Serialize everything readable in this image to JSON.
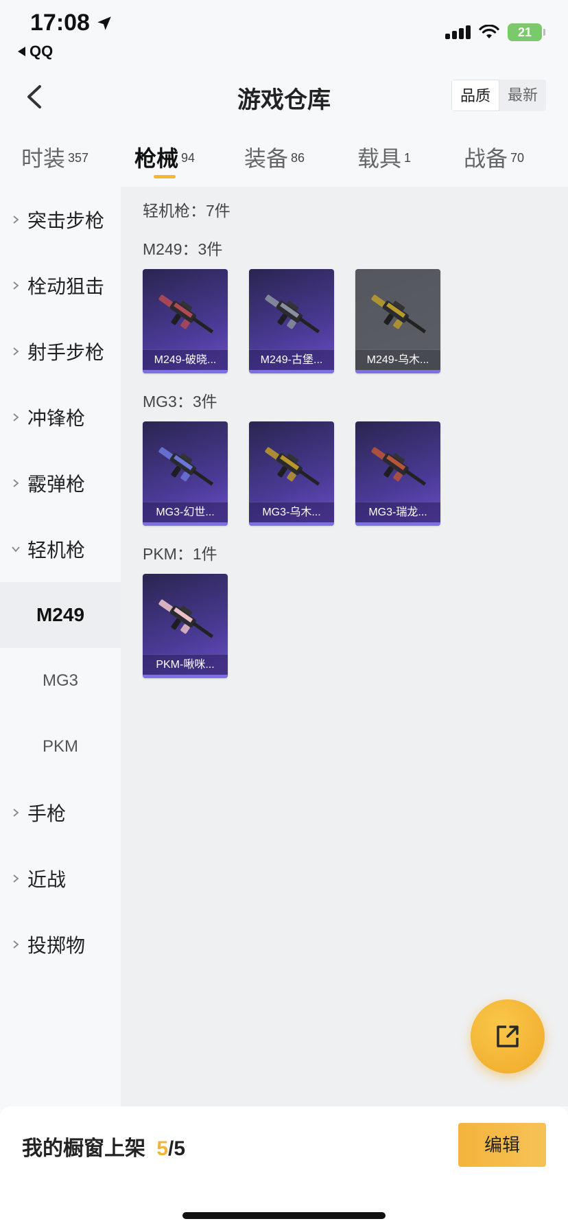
{
  "status": {
    "time": "17:08",
    "back_app": "QQ",
    "battery": "21"
  },
  "header": {
    "title": "游戏仓库",
    "sort_options": [
      "品质",
      "最新"
    ],
    "sort_active": 0
  },
  "tabs": [
    {
      "label": "时装",
      "count": "357"
    },
    {
      "label": "枪械",
      "count": "94"
    },
    {
      "label": "装备",
      "count": "86"
    },
    {
      "label": "载具",
      "count": "1"
    },
    {
      "label": "战备",
      "count": "70"
    }
  ],
  "active_tab": 1,
  "sidebar": {
    "items": [
      {
        "label": "突击步枪"
      },
      {
        "label": "栓动狙击"
      },
      {
        "label": "射手步枪"
      },
      {
        "label": "冲锋枪"
      },
      {
        "label": "霰弹枪"
      },
      {
        "label": "轻机枪"
      }
    ],
    "subitems": [
      "M249",
      "MG3",
      "PKM"
    ],
    "items_after": [
      {
        "label": "手枪"
      },
      {
        "label": "近战"
      },
      {
        "label": "投掷物"
      }
    ]
  },
  "content": {
    "category_title": "轻机枪：7件",
    "groups": [
      {
        "title": "M249：3件",
        "items": [
          {
            "name": "M249-破晓...",
            "color": "#b24a52"
          },
          {
            "name": "M249-古堡...",
            "color": "#8a8fa0"
          },
          {
            "name": "M249-乌木...",
            "color": "#b89a2c"
          }
        ]
      },
      {
        "title": "MG3：3件",
        "items": [
          {
            "name": "MG3-幻世...",
            "color": "#6b75d8"
          },
          {
            "name": "MG3-乌木...",
            "color": "#b8962c"
          },
          {
            "name": "MG3-瑞龙...",
            "color": "#b8543a"
          }
        ]
      },
      {
        "title": "PKM：1件",
        "items": [
          {
            "name": "PKM-啾咪...",
            "color": "#e9c0c8"
          }
        ]
      }
    ]
  },
  "bottom": {
    "shelf_label": "我的橱窗上架",
    "shelf_count": "5",
    "shelf_total": "/5",
    "edit_label": "编辑"
  },
  "colors": {
    "accent": "#f5b731",
    "card_purple": "#4a3a95"
  }
}
